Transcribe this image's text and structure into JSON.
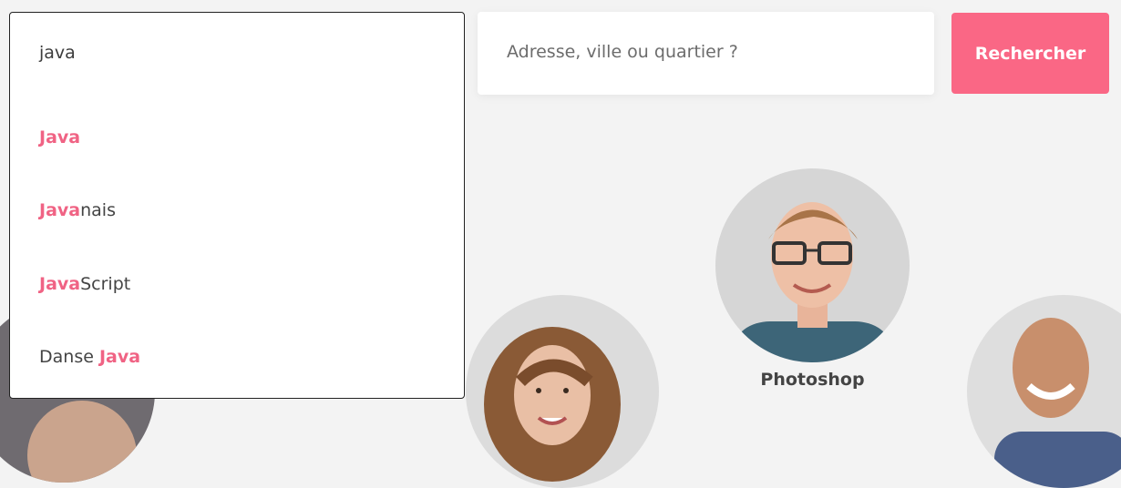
{
  "search": {
    "query": "java",
    "suggestions": [
      {
        "match": "Java",
        "rest": ""
      },
      {
        "match": "Java",
        "rest": "nais"
      },
      {
        "match": "Java",
        "rest": "Script"
      },
      {
        "prefix": "Danse ",
        "match": "Java"
      }
    ]
  },
  "address": {
    "placeholder": "Adresse, ville ou quartier ?"
  },
  "actions": {
    "search_label": "Rechercher"
  },
  "subjects": {
    "center_label": "Photoshop"
  },
  "colors": {
    "accent": "#fa6785",
    "highlight": "#f06384",
    "background": "#f3f3f3"
  }
}
